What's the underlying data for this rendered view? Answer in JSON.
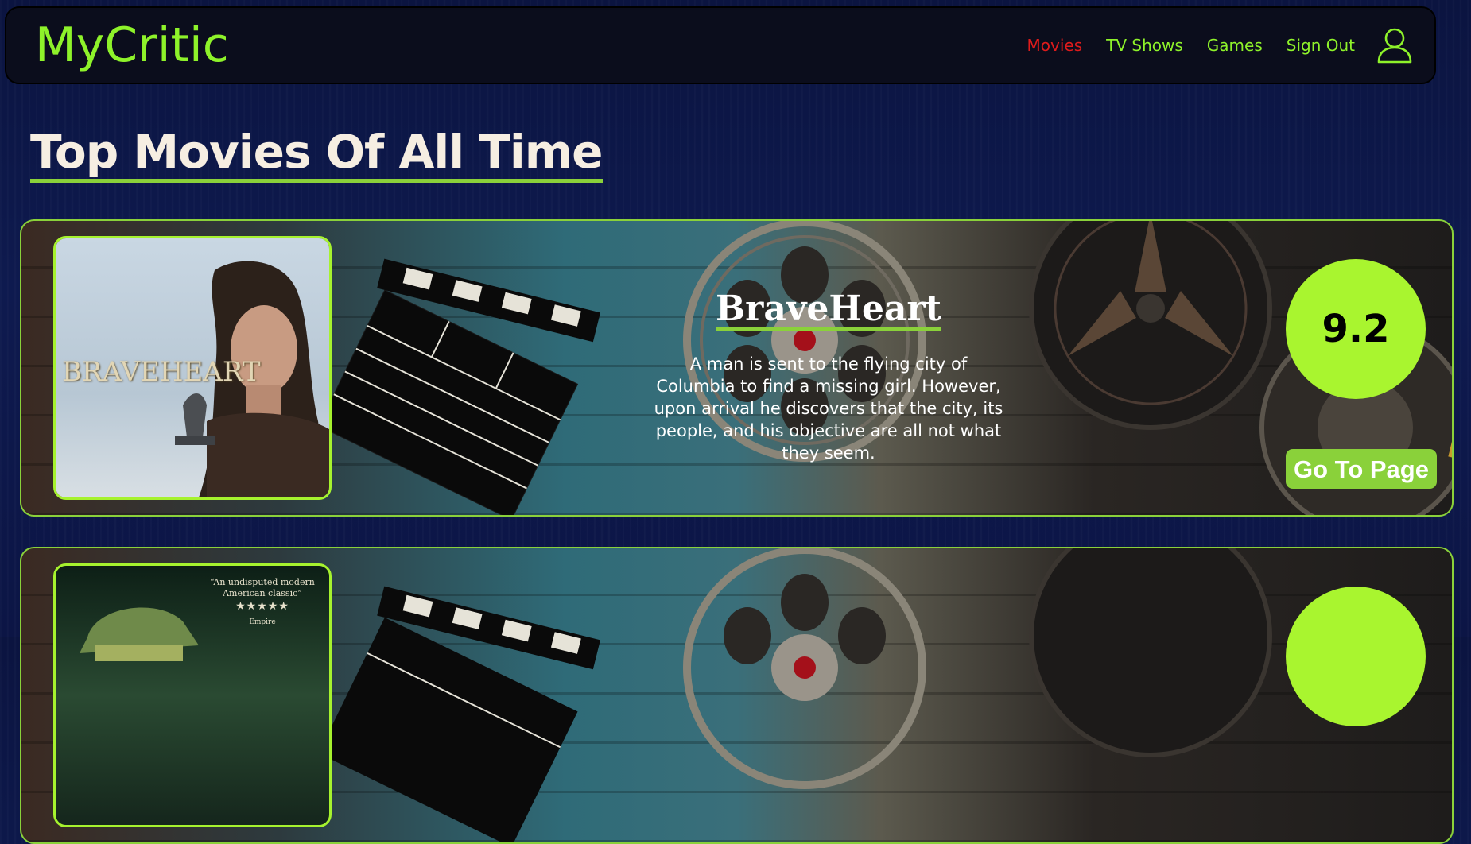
{
  "navbar": {
    "brand": "MyCritic",
    "links": [
      "Movies",
      "TV Shows",
      "Games",
      "Sign Out"
    ],
    "active_link": "Movies"
  },
  "page_title": "Top Movies Of All Time",
  "movies": [
    {
      "poster_text": "BRAVEHEART",
      "title": "BraveHeart",
      "description": "A man is sent to the flying city of Columbia to find a missing girl. However, upon arrival he discovers that the city, its people, and his objective are all not what they seem.",
      "rating": "9.2",
      "button_label": "Go To Page"
    },
    {
      "poster_quote": "“An undisputed modern American classic”",
      "poster_stars": "★★★★★",
      "poster_source": "Empire"
    }
  ],
  "colors": {
    "accent_green": "#8ef22a",
    "rating_green": "#a9f52f",
    "button_green": "#8ad13a",
    "active_red": "#e01b1b",
    "navbar_bg": "#0b0d1c",
    "page_bg": "#0e1a4f"
  },
  "icons": {
    "user": "user-outline-icon"
  }
}
